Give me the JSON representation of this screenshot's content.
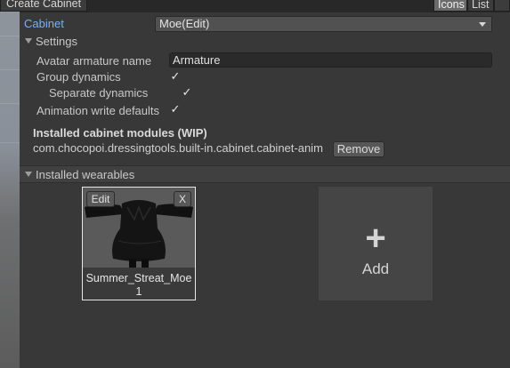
{
  "toolbar": {
    "create_label": "Create Cabinet",
    "icons_label": "Icons",
    "list_label": "List"
  },
  "cabinet": {
    "label": "Cabinet",
    "selected": "Moe(Edit)"
  },
  "settings": {
    "header": "Settings",
    "avatar_armature_label": "Avatar armature name",
    "avatar_armature_value": "Armature",
    "group_dynamics_label": "Group dynamics",
    "group_dynamics_checked": true,
    "separate_dynamics_label": "Separate dynamics",
    "separate_dynamics_checked": true,
    "anim_write_defaults_label": "Animation write defaults",
    "anim_write_defaults_checked": true
  },
  "modules": {
    "header": "Installed cabinet modules (WIP)",
    "items": [
      {
        "name": "com.chocopoi.dressingtools.built-in.cabinet.cabinet-anim",
        "remove_label": "Remove"
      }
    ]
  },
  "wearables": {
    "header": "Installed wearables",
    "items": [
      {
        "name": "Summer_Streat_Moe 1",
        "edit_label": "Edit",
        "remove_label": "X"
      }
    ],
    "add_label": "Add",
    "add_symbol": "+"
  },
  "colors": {
    "panel_bg": "#383838",
    "accent_label": "#79b1ef",
    "selected_toggle": "#6b6b6b"
  }
}
